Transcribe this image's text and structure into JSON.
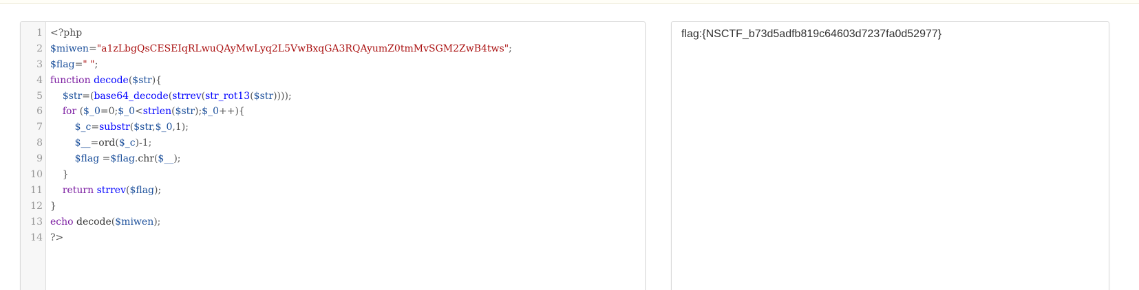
{
  "editor": {
    "lines": [
      {
        "number": "1",
        "tokens": [
          {
            "t": "<?php",
            "c": "tag"
          }
        ]
      },
      {
        "number": "2",
        "tokens": [
          {
            "t": "$miwen",
            "c": "var"
          },
          {
            "t": "=",
            "c": "op"
          },
          {
            "t": "\"a1zLbgQsCESEIqRLwuQAyMwLyq2L5VwBxqGA3RQAyumZ0tmMvSGM2ZwB4tws\"",
            "c": "str"
          },
          {
            "t": ";",
            "c": "op"
          }
        ]
      },
      {
        "number": "3",
        "tokens": [
          {
            "t": "$flag",
            "c": "var"
          },
          {
            "t": "=",
            "c": "op"
          },
          {
            "t": "\" \"",
            "c": "str"
          },
          {
            "t": ";",
            "c": "op"
          }
        ]
      },
      {
        "number": "4",
        "tokens": [
          {
            "t": "function",
            "c": "kw"
          },
          {
            "t": " ",
            "c": "op"
          },
          {
            "t": "decode",
            "c": "def"
          },
          {
            "t": "(",
            "c": "op"
          },
          {
            "t": "$str",
            "c": "var"
          },
          {
            "t": "){",
            "c": "op"
          }
        ]
      },
      {
        "number": "5",
        "tokens": [
          {
            "t": "    ",
            "c": "op"
          },
          {
            "t": "$str",
            "c": "var"
          },
          {
            "t": "=(",
            "c": "op"
          },
          {
            "t": "base64_decode",
            "c": "def"
          },
          {
            "t": "(",
            "c": "op"
          },
          {
            "t": "strrev",
            "c": "def"
          },
          {
            "t": "(",
            "c": "op"
          },
          {
            "t": "str_rot13",
            "c": "def"
          },
          {
            "t": "(",
            "c": "op"
          },
          {
            "t": "$str",
            "c": "var"
          },
          {
            "t": "))));",
            "c": "op"
          }
        ]
      },
      {
        "number": "6",
        "tokens": [
          {
            "t": "    ",
            "c": "op"
          },
          {
            "t": "for",
            "c": "kw"
          },
          {
            "t": " (",
            "c": "op"
          },
          {
            "t": "$_0",
            "c": "var"
          },
          {
            "t": "=0;",
            "c": "op"
          },
          {
            "t": "$_0",
            "c": "var"
          },
          {
            "t": "<",
            "c": "op"
          },
          {
            "t": "strlen",
            "c": "def"
          },
          {
            "t": "(",
            "c": "op"
          },
          {
            "t": "$str",
            "c": "var"
          },
          {
            "t": ");",
            "c": "op"
          },
          {
            "t": "$_0",
            "c": "var"
          },
          {
            "t": "++){",
            "c": "op"
          }
        ]
      },
      {
        "number": "7",
        "tokens": [
          {
            "t": "        ",
            "c": "op"
          },
          {
            "t": "$_c",
            "c": "var"
          },
          {
            "t": "=",
            "c": "op"
          },
          {
            "t": "substr",
            "c": "def"
          },
          {
            "t": "(",
            "c": "op"
          },
          {
            "t": "$str",
            "c": "var"
          },
          {
            "t": ",",
            "c": "op"
          },
          {
            "t": "$_0",
            "c": "var"
          },
          {
            "t": ",1);",
            "c": "op"
          }
        ]
      },
      {
        "number": "8",
        "tokens": [
          {
            "t": "        ",
            "c": "op"
          },
          {
            "t": "$__",
            "c": "var"
          },
          {
            "t": "=",
            "c": "op"
          },
          {
            "t": "ord",
            "c": "fn"
          },
          {
            "t": "(",
            "c": "op"
          },
          {
            "t": "$_c",
            "c": "var"
          },
          {
            "t": ")-1;",
            "c": "op"
          }
        ]
      },
      {
        "number": "9",
        "tokens": [
          {
            "t": "        ",
            "c": "op"
          },
          {
            "t": "$flag",
            "c": "var"
          },
          {
            "t": " =",
            "c": "op"
          },
          {
            "t": "$flag",
            "c": "var"
          },
          {
            "t": ".",
            "c": "op"
          },
          {
            "t": "chr",
            "c": "fn"
          },
          {
            "t": "(",
            "c": "op"
          },
          {
            "t": "$__",
            "c": "var"
          },
          {
            "t": ");",
            "c": "op"
          }
        ]
      },
      {
        "number": "10",
        "tokens": [
          {
            "t": "    }",
            "c": "op"
          }
        ]
      },
      {
        "number": "11",
        "tokens": [
          {
            "t": "    ",
            "c": "op"
          },
          {
            "t": "return",
            "c": "kw"
          },
          {
            "t": " ",
            "c": "op"
          },
          {
            "t": "strrev",
            "c": "def"
          },
          {
            "t": "(",
            "c": "op"
          },
          {
            "t": "$flag",
            "c": "var"
          },
          {
            "t": ");",
            "c": "op"
          }
        ]
      },
      {
        "number": "12",
        "tokens": [
          {
            "t": "}",
            "c": "op"
          }
        ]
      },
      {
        "number": "13",
        "tokens": [
          {
            "t": "echo",
            "c": "kw"
          },
          {
            "t": " ",
            "c": "op"
          },
          {
            "t": "decode",
            "c": "fn"
          },
          {
            "t": "(",
            "c": "op"
          },
          {
            "t": "$miwen",
            "c": "var"
          },
          {
            "t": ");",
            "c": "op"
          }
        ]
      },
      {
        "number": "14",
        "tokens": [
          {
            "t": "?>",
            "c": "tag"
          }
        ]
      }
    ]
  },
  "output": {
    "text": "flag:{NSCTF_b73d5adfb819c64603d7237fa0d52977}"
  }
}
